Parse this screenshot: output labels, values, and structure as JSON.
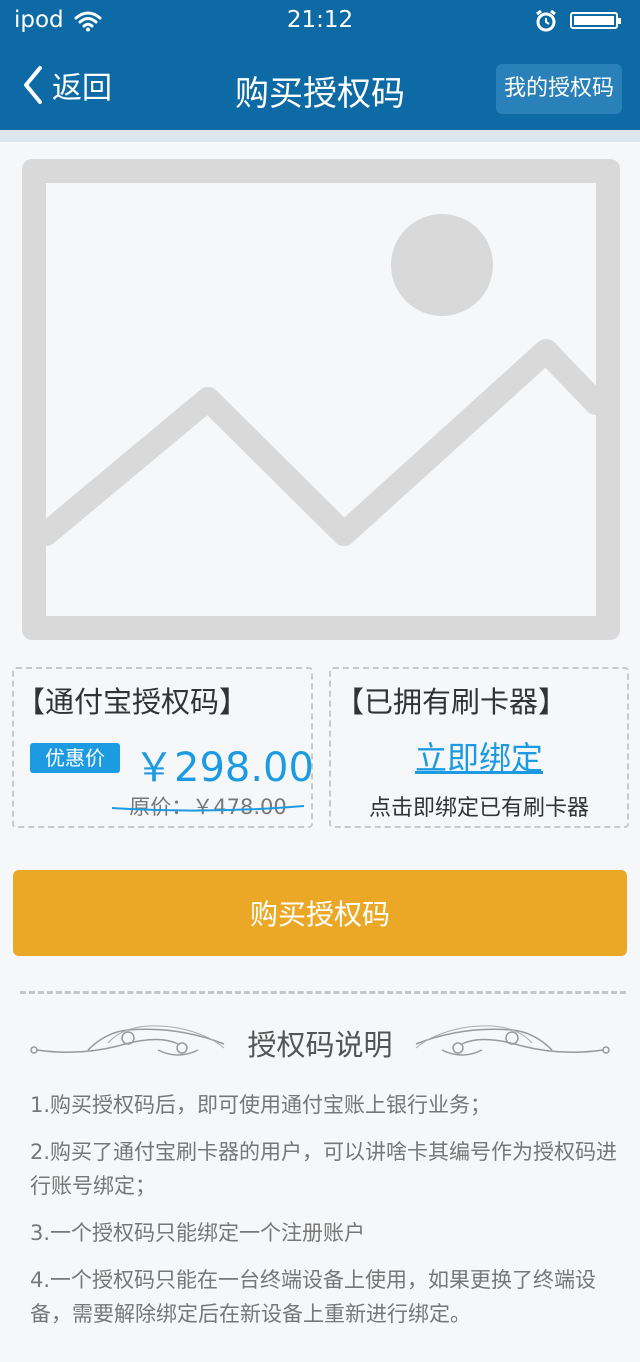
{
  "status_bar": {
    "carrier": "ipod",
    "time": "21:12",
    "icons": [
      "wifi-icon",
      "alarm-icon",
      "battery-icon"
    ]
  },
  "nav": {
    "back_label": "返回",
    "title": "购买授权码",
    "my_codes_label": "我的授权码"
  },
  "hero_image": {
    "icon": "image-placeholder-icon"
  },
  "card_left": {
    "title": "【通付宝授权码】",
    "badge": "优惠价",
    "price": "￥298.00",
    "original_price": "原价：￥478.00"
  },
  "card_right": {
    "title": "【已拥有刷卡器】",
    "link": "立即绑定",
    "desc": "点击即绑定已有刷卡器"
  },
  "buy_button_label": "购买授权码",
  "explanation": {
    "title": "授权码说明",
    "items": [
      "1.购买授权码后，即可使用通付宝账上银行业务；",
      "2.购买了通付宝刷卡器的用户，可以讲啥卡其编号作为授权码进行账号绑定；",
      "3.一个授权码只能绑定一个注册账户",
      "4.一个授权码只能在一台终端设备上使用，如果更换了终端设备，需要解除绑定后在新设备上重新进行绑定。"
    ]
  },
  "colors": {
    "nav_bg": "#0d6aa4",
    "accent_blue": "#1c9be3",
    "buy_button": "#eba826",
    "placeholder_gray": "#d9d9d9"
  }
}
